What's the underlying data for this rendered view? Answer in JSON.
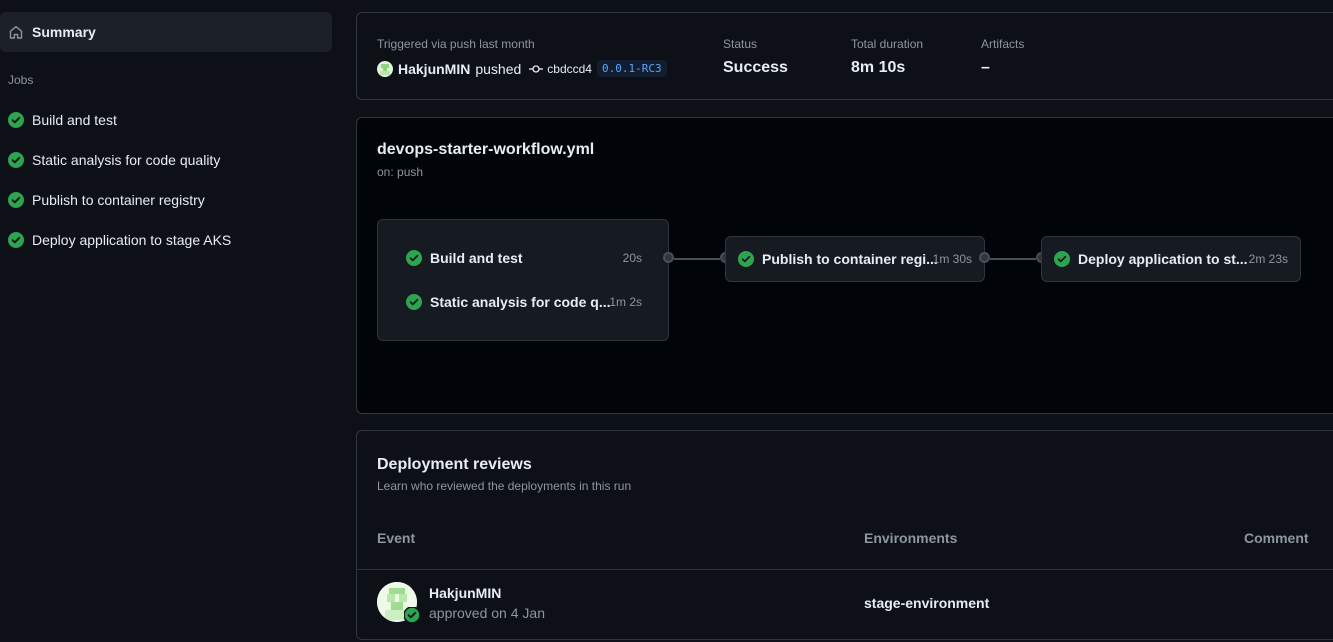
{
  "colors": {
    "success": "#2da44e",
    "background": "#0d1117",
    "border": "#30363d",
    "muted_text": "#8d96a0",
    "link_blue": "#58a6ff"
  },
  "sidebar": {
    "summary": {
      "label": "Summary",
      "icon": "home-icon"
    },
    "jobs_heading": "Jobs",
    "jobs": [
      {
        "label": "Build and test",
        "status": "success"
      },
      {
        "label": "Static analysis for code quality",
        "status": "success"
      },
      {
        "label": "Publish to container registry",
        "status": "success"
      },
      {
        "label": "Deploy application to stage AKS",
        "status": "success"
      }
    ]
  },
  "run_summary": {
    "trigger_text": "Triggered via push last month",
    "actor": "HakjunMIN",
    "verb": "pushed",
    "commit_sha": "cbdccd4",
    "tag": "0.0.1-RC3",
    "status_label": "Status",
    "status_value": "Success",
    "duration_label": "Total duration",
    "duration_value": "8m 10s",
    "artifacts_label": "Artifacts",
    "artifacts_value": "–"
  },
  "workflow": {
    "file_name": "devops-starter-workflow.yml",
    "trigger": "on: push",
    "group_jobs": [
      {
        "name": "Build and test",
        "duration": "20s"
      },
      {
        "name": "Static analysis for code q...",
        "duration": "1m 2s"
      }
    ],
    "publish_job": {
      "name": "Publish to container regi...",
      "duration": "1m 30s"
    },
    "deploy_job": {
      "name": "Deploy application to st...",
      "duration": "2m 23s"
    }
  },
  "reviews": {
    "title": "Deployment reviews",
    "subtitle": "Learn who reviewed the deployments in this run",
    "columns": {
      "event": "Event",
      "environments": "Environments",
      "comment": "Comment"
    },
    "rows": [
      {
        "actor": "HakjunMIN",
        "action": "approved on 4 Jan",
        "environment": "stage-environment"
      }
    ]
  }
}
